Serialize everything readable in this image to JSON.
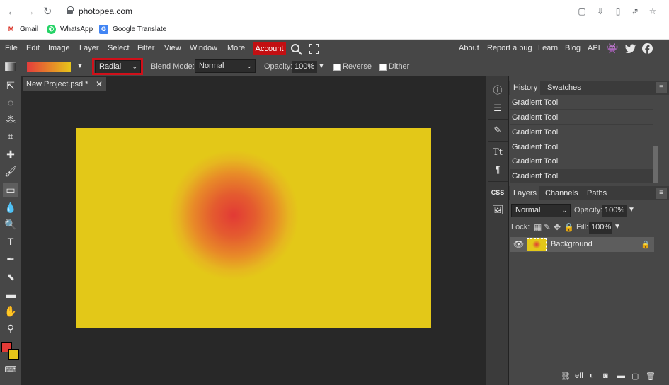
{
  "browser": {
    "url": "photopea.com",
    "bookmarks": [
      {
        "label": "Gmail"
      },
      {
        "label": "WhatsApp"
      },
      {
        "label": "Google Translate"
      }
    ]
  },
  "menubar": {
    "items": [
      "File",
      "Edit",
      "Image",
      "Layer",
      "Select",
      "Filter",
      "View",
      "Window",
      "More"
    ],
    "account": "Account",
    "right": [
      "About",
      "Report a bug",
      "Learn",
      "Blog",
      "API"
    ]
  },
  "options": {
    "gradient_type": "Radial",
    "blend_label": "Blend Mode:",
    "blend_value": "Normal",
    "opacity_label": "Opacity:",
    "opacity_value": "100%",
    "reverse_label": "Reverse",
    "dither_label": "Dither",
    "colors": {
      "start": "#e43c3c",
      "end": "#e7c519"
    }
  },
  "document": {
    "tab_title": "New Project.psd *",
    "canvas_colors": {
      "center": "#e23a35",
      "edge": "#e3c818"
    }
  },
  "history": {
    "tabs": [
      "History",
      "Swatches"
    ],
    "items": [
      "Gradient Tool",
      "Gradient Tool",
      "Gradient Tool",
      "Gradient Tool",
      "Gradient Tool",
      "Gradient Tool"
    ]
  },
  "layers": {
    "tabs": [
      "Layers",
      "Channels",
      "Paths"
    ],
    "blend_mode": "Normal",
    "opacity_label": "Opacity:",
    "opacity_value": "100%",
    "lock_label": "Lock:",
    "fill_label": "Fill:",
    "fill_value": "100%",
    "items": [
      {
        "name": "Background"
      }
    ]
  },
  "footer_icons": [
    "link-icon",
    "effects-icon",
    "adjustment-icon",
    "mask-icon",
    "folder-icon",
    "new-layer-icon",
    "trash-icon"
  ],
  "mini_panel_text": {
    "css": "CSS"
  }
}
